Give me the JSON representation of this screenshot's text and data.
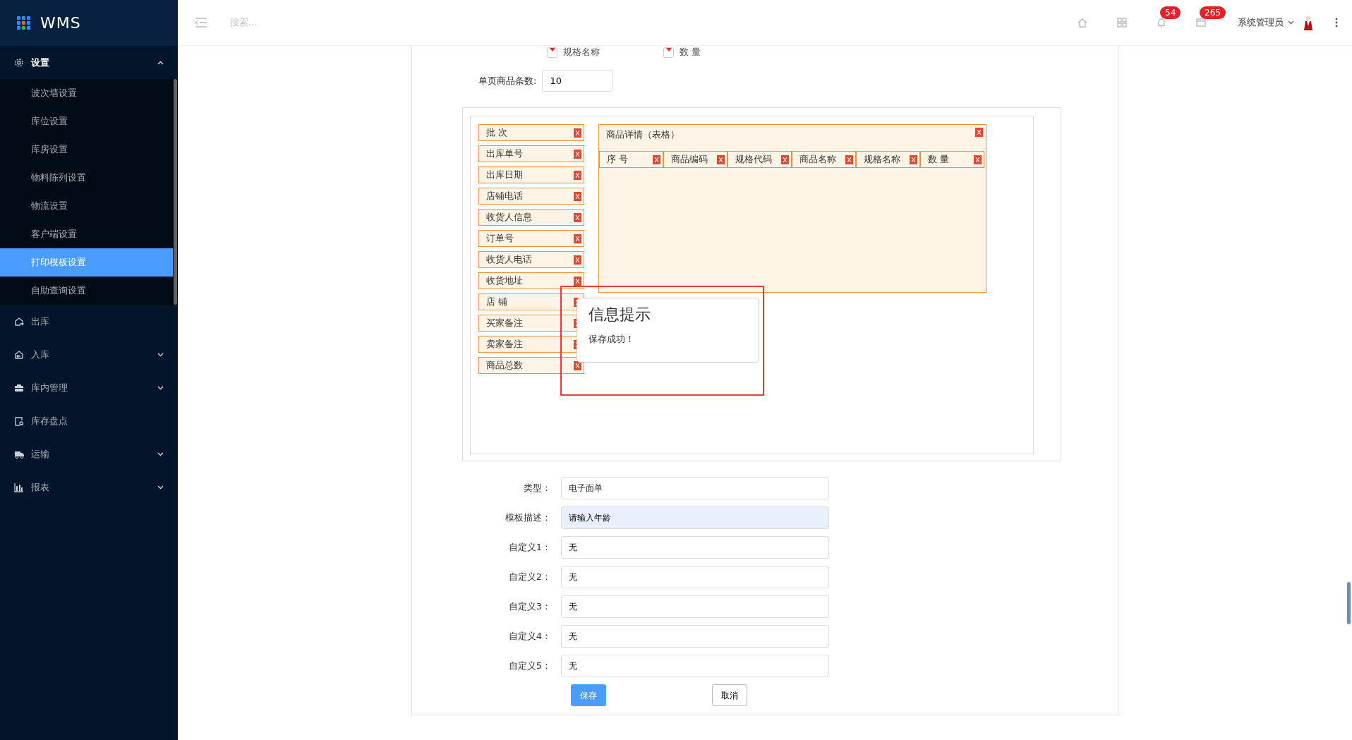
{
  "brand": {
    "title": "WMS"
  },
  "header": {
    "search": {
      "placeholder": "搜索..."
    },
    "badges": [
      {
        "count": "54"
      },
      {
        "count": "265"
      }
    ],
    "user": "系统管理员"
  },
  "sidebar": {
    "items": [
      {
        "label": "设置",
        "kind": "group",
        "expanded": true,
        "children": [
          {
            "label": "波次墙设置",
            "selected": false
          },
          {
            "label": "库位设置",
            "selected": false
          },
          {
            "label": "库房设置",
            "selected": false
          },
          {
            "label": "物料陈列设置",
            "selected": false
          },
          {
            "label": "物流设置",
            "selected": false
          },
          {
            "label": "客户端设置",
            "selected": false
          },
          {
            "label": "打印模板设置",
            "selected": true
          },
          {
            "label": "自助查询设置",
            "selected": false
          }
        ]
      },
      {
        "label": "出库",
        "kind": "link"
      },
      {
        "label": "入库",
        "kind": "group",
        "expanded": false
      },
      {
        "label": "库内管理",
        "kind": "group",
        "expanded": false
      },
      {
        "label": "库存盘点",
        "kind": "link"
      },
      {
        "label": "运输",
        "kind": "group",
        "expanded": false
      },
      {
        "label": "报表",
        "kind": "group",
        "expanded": false
      }
    ]
  },
  "column_options": [
    {
      "label": "规格名称",
      "checked": true
    },
    {
      "label": "数 量",
      "checked": true
    }
  ],
  "page_size": {
    "label": "单页商品条数:",
    "value": "10"
  },
  "designer": {
    "fields": [
      {
        "label": "批 次"
      },
      {
        "label": "出库单号"
      },
      {
        "label": "出库日期"
      },
      {
        "label": "店铺电话"
      },
      {
        "label": "收货人信息"
      },
      {
        "label": "订单号"
      },
      {
        "label": "收货人电话"
      },
      {
        "label": "收货地址"
      },
      {
        "label": "店 铺"
      },
      {
        "label": "买家备注"
      },
      {
        "label": "卖家备注"
      },
      {
        "label": "商品总数"
      }
    ],
    "table": {
      "title": "商品详情（表格）",
      "columns": [
        "序 号",
        "商品编码",
        "规格代码",
        "商品名称",
        "规格名称",
        "数 量"
      ]
    }
  },
  "dialog": {
    "title": "信息提示",
    "message": "保存成功！"
  },
  "form": {
    "rows": [
      {
        "kind": "select",
        "label": "类型：",
        "value": "电子面单"
      },
      {
        "kind": "text",
        "label": "模板描述：",
        "value": "请输入年龄",
        "autofilled": true
      },
      {
        "kind": "text",
        "label": "自定义1：",
        "value": "无",
        "autofilled": false
      },
      {
        "kind": "text",
        "label": "自定义2：",
        "value": "无",
        "autofilled": false
      },
      {
        "kind": "text",
        "label": "自定义3：",
        "value": "无",
        "autofilled": false
      },
      {
        "kind": "text",
        "label": "自定义4：",
        "value": "无",
        "autofilled": false
      },
      {
        "kind": "text",
        "label": "自定义5：",
        "value": "无",
        "autofilled": false
      }
    ],
    "buttons": [
      {
        "label": "保存",
        "kind": "primary"
      },
      {
        "label": "取消",
        "kind": "secondary"
      }
    ]
  }
}
